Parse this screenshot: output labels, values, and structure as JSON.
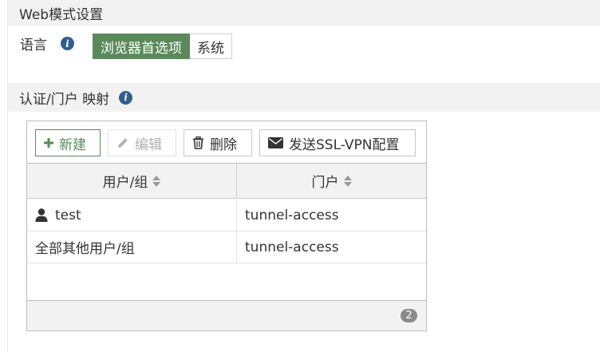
{
  "web_mode": {
    "header": "Web模式设置",
    "language_label": "语言",
    "language_options": [
      "浏览器首选项",
      "系统"
    ],
    "language_selected": "浏览器首选项"
  },
  "auth_portal": {
    "header": "认证/门户 映射",
    "toolbar": {
      "new_label": "新建",
      "edit_label": "编辑",
      "delete_label": "删除",
      "send_label": "发送SSL-VPN配置"
    },
    "columns": [
      "用户/组",
      "门户"
    ],
    "rows": [
      {
        "user": "test",
        "portal": "tunnel-access",
        "icon": "user-icon"
      },
      {
        "user": "全部其他用户/组",
        "portal": "tunnel-access",
        "icon": ""
      }
    ],
    "count": "2"
  },
  "colors": {
    "accent_green": "#5a8a5a",
    "info_blue": "#2f5f8f",
    "header_bg": "#f2f2f2"
  }
}
